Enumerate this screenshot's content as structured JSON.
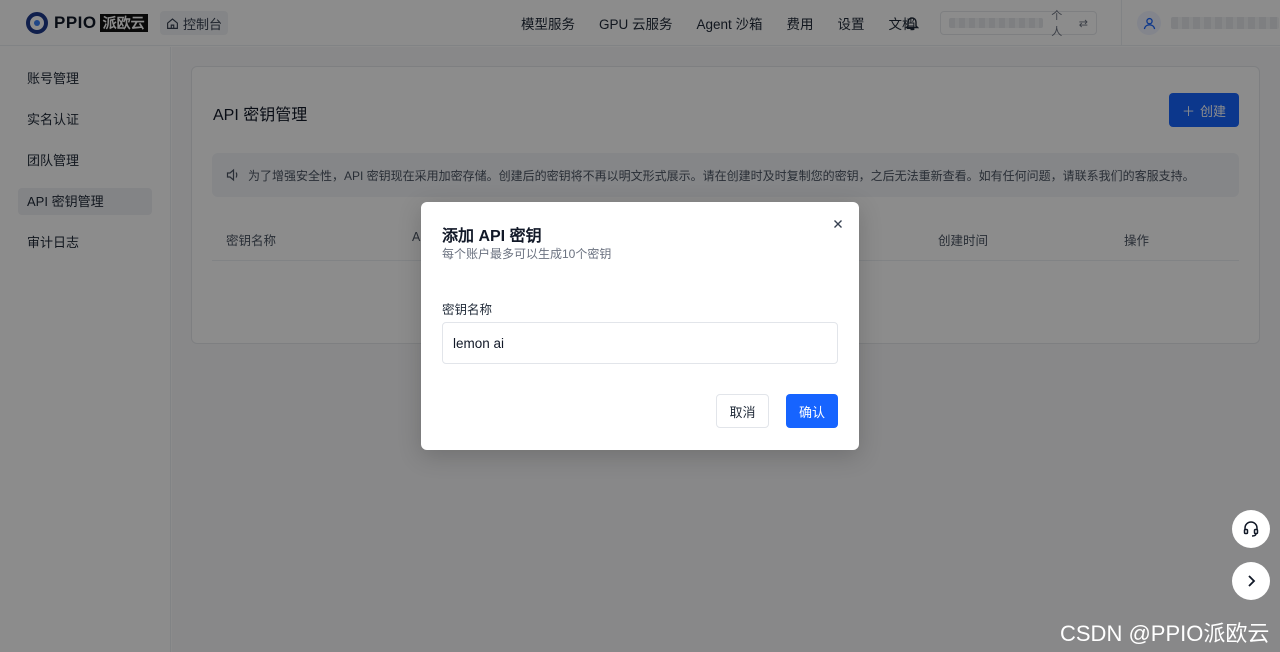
{
  "header": {
    "logo_text": "PPIO",
    "logo_cn": "派欧云",
    "console_label": "控制台",
    "nav_items": [
      "模型服务",
      "GPU 云服务",
      "Agent 沙箱",
      "费用",
      "设置",
      "文档"
    ],
    "account_type": "个人",
    "switch_icon": "⇄"
  },
  "sidebar": {
    "items": [
      {
        "label": "账号管理"
      },
      {
        "label": "实名认证"
      },
      {
        "label": "团队管理"
      },
      {
        "label": "API 密钥管理"
      },
      {
        "label": "审计日志"
      }
    ]
  },
  "main": {
    "title": "API 密钥管理",
    "create_label": "创建",
    "notice": "为了增强安全性，API 密钥现在采用加密存储。创建后的密钥将不再以明文形式展示。请在创建时及时复制您的密钥，之后无法重新查看。如有任何问题，请联系我们的客服支持。",
    "columns": [
      "密钥名称",
      "A",
      "创建时间",
      "操作"
    ]
  },
  "modal": {
    "title": "添加 API 密钥",
    "subtitle": "每个账户最多可以生成10个密钥",
    "field_label": "密钥名称",
    "field_value": "lemon ai",
    "cancel_label": "取消",
    "confirm_label": "确认"
  },
  "watermark": "CSDN @PPIO派欧云",
  "colors": {
    "primary": "#1664ff",
    "overlay": "rgba(0,0,0,0.45)"
  }
}
